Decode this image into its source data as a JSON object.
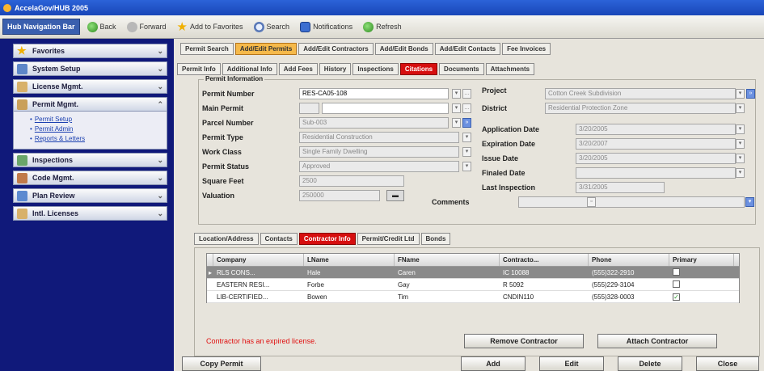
{
  "window": {
    "title": "AccelaGov/HUB 2005"
  },
  "navbar": {
    "label": "Hub Navigation Bar",
    "buttons": [
      "Back",
      "Forward",
      "Add to Favorites",
      "Search",
      "Notifications",
      "Refresh"
    ]
  },
  "sidebar": {
    "items": [
      {
        "label": "Favorites",
        "icon": "star-icon"
      },
      {
        "label": "System Setup",
        "icon": "monitor-icon"
      },
      {
        "label": "License Mgmt.",
        "icon": "license-icon"
      },
      {
        "label": "Permit Mgmt.",
        "icon": "permit-icon"
      },
      {
        "label": "Inspections",
        "icon": "inspection-icon"
      },
      {
        "label": "Code Mgmt.",
        "icon": "code-icon"
      },
      {
        "label": "Plan Review",
        "icon": "plan-icon"
      },
      {
        "label": "Intl. Licenses",
        "icon": "license-icon"
      }
    ],
    "permit_links": [
      "Permit Setup",
      "Permit Admin",
      "Reports & Letters"
    ]
  },
  "top_tabs": [
    "Permit Search",
    "Add/Edit Permits",
    "Add/Edit Contractors",
    "Add/Edit Bonds",
    "Add/Edit Contacts",
    "Fee Invoices"
  ],
  "sub_tabs": [
    "Permit Info",
    "Additional Info",
    "Add Fees",
    "History",
    "Inspections",
    "Citations",
    "Documents",
    "Attachments"
  ],
  "permit_info": {
    "group_title": "Permit Information",
    "fields": {
      "permit_number": {
        "label": "Permit Number",
        "value": "RES-CA05-108"
      },
      "main_permit": {
        "label": "Main Permit",
        "value": ""
      },
      "parcel_number": {
        "label": "Parcel Number",
        "value": "Sub-003"
      },
      "permit_type": {
        "label": "Permit Type",
        "value": "Residential Construction"
      },
      "work_class": {
        "label": "Work Class",
        "value": "Single Family Dwelling"
      },
      "permit_status": {
        "label": "Permit Status",
        "value": "Approved"
      },
      "square_feet": {
        "label": "Square Feet",
        "value": "2500"
      },
      "valuation": {
        "label": "Valuation",
        "value": "250000"
      },
      "project": {
        "label": "Project",
        "value": "Cotton Creek Subdivision"
      },
      "district": {
        "label": "District",
        "value": "Residential Protection Zone"
      },
      "application_date": {
        "label": "Application Date",
        "value": "3/20/2005"
      },
      "expiration_date": {
        "label": "Expiration Date",
        "value": "3/20/2007"
      },
      "issue_date": {
        "label": "Issue Date",
        "value": "3/20/2005"
      },
      "finaled_date": {
        "label": "Finaled Date",
        "value": ""
      },
      "last_inspection": {
        "label": "Last Inspection",
        "value": "3/31/2005"
      },
      "comments": {
        "label": "Comments",
        "value": ""
      }
    }
  },
  "lower_tabs": [
    "Location/Address",
    "Contacts",
    "Contractor Info",
    "Permit/Credit Ltd",
    "Bonds"
  ],
  "contractor_grid": {
    "columns": [
      "Company",
      "LName",
      "FName",
      "Contracto...",
      "Phone",
      "Primary"
    ],
    "rows": [
      {
        "company": "RLS CONS...",
        "lname": "Hale",
        "fname": "Caren",
        "contractor": "IC 10088",
        "phone": "(555)322-2910",
        "primary": false,
        "selected": true
      },
      {
        "company": "EASTERN RESI...",
        "lname": "Forbe",
        "fname": "Gay",
        "contractor": "R 5092",
        "phone": "(555)229-3104",
        "primary": false,
        "selected": false
      },
      {
        "company": "LIB-CERTIFIED...",
        "lname": "Bowen",
        "fname": "Tim",
        "contractor": "CNDIN110",
        "phone": "(555)328-0003",
        "primary": true,
        "selected": false
      }
    ]
  },
  "warning": "Contractor has an expired license.",
  "buttons": {
    "remove_contractor": "Remove Contractor",
    "attach_contractor": "Attach Contractor",
    "copy_permit": "Copy Permit",
    "add": "Add",
    "edit": "Edit",
    "delete": "Delete",
    "close": "Close"
  }
}
